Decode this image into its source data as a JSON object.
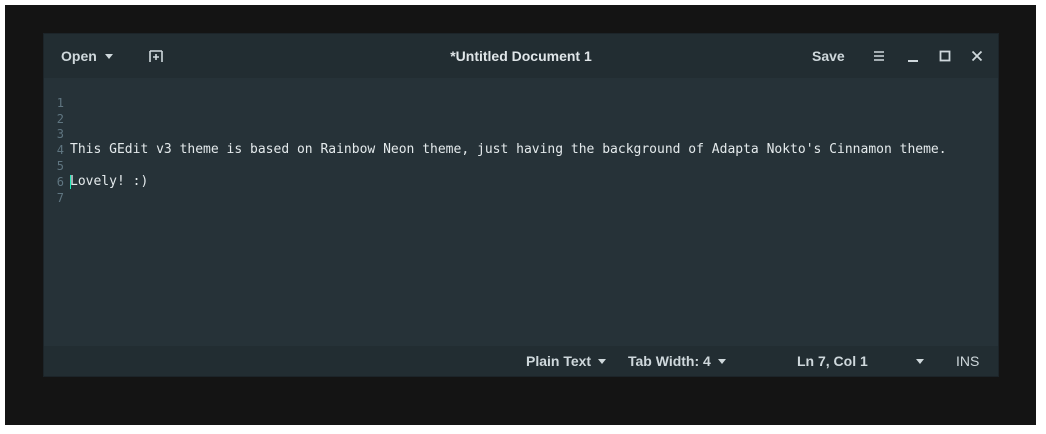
{
  "window": {
    "title": "*Untitled Document 1"
  },
  "headerbar": {
    "open_label": "Open",
    "new_tab_icon": "new-tab-icon",
    "save_label": "Save",
    "menu_icon": "hamburger-menu-icon",
    "minimize_icon": "minimize-icon",
    "maximize_icon": "maximize-icon",
    "close_icon": "close-icon"
  },
  "editor": {
    "lines": [
      {
        "number": "1",
        "text": ""
      },
      {
        "number": "2",
        "text": ""
      },
      {
        "number": "3",
        "text": "This GEdit v3 theme is based on Rainbow Neon theme, just having the background of Adapta Nokto's Cinnamon theme."
      },
      {
        "number": "4",
        "text": ""
      },
      {
        "number": "5",
        "text": "Lovely! :)"
      },
      {
        "number": "6",
        "text": ""
      },
      {
        "number": "7",
        "text": ""
      }
    ]
  },
  "statusbar": {
    "language": "Plain Text",
    "tab_width": "Tab Width: 4",
    "position": "Ln 7, Col 1",
    "mode": "INS"
  },
  "colors": {
    "background": "#263238",
    "headerbar": "#222d32",
    "text": "#e4eaec",
    "line_numbers": "#5f7580",
    "cursor": "#1de9b6"
  }
}
